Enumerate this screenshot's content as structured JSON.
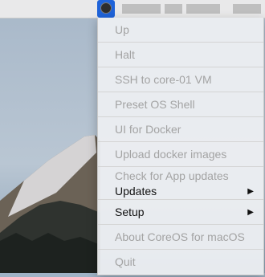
{
  "menu": {
    "items": [
      {
        "label": "Up"
      },
      {
        "label": "Halt"
      },
      {
        "label": "SSH to core-01 VM"
      },
      {
        "label": "Preset OS Shell"
      },
      {
        "label": "UI for Docker"
      },
      {
        "label": "Upload docker images"
      },
      {
        "label": "Check for App updates"
      },
      {
        "label": "Updates"
      },
      {
        "label": "Setup"
      },
      {
        "label": "About CoreOS for macOS"
      },
      {
        "label": "Quit"
      }
    ],
    "submenu_arrow": "▶"
  },
  "icons": {
    "status_icon": "coreos-status-icon"
  }
}
